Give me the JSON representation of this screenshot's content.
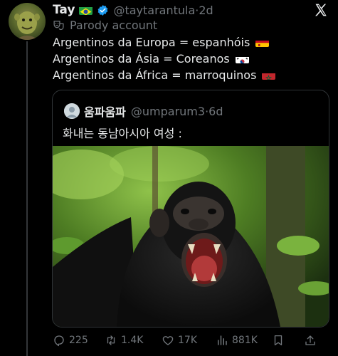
{
  "tweet": {
    "display_name": "Tay",
    "handle": "@taytarantula",
    "time_sep": "·",
    "time": "2d",
    "label": "Parody account",
    "lines": [
      "Argentinos da Europa = espanhóis",
      "Argentinos da Ásia = Coreanos",
      "Argentinos da África = marroquinos"
    ]
  },
  "quote": {
    "display_name": "움파움파",
    "handle": "@umparum3",
    "time_sep": "·",
    "time": "6d",
    "text": "화내는 동남아시아 여성 :"
  },
  "actions": {
    "replies": "225",
    "reposts": "1.4K",
    "likes": "17K",
    "views": "881K"
  },
  "colors": {
    "background": "#000000",
    "text": "#e7e9ea",
    "muted": "#71767b",
    "border": "#2f3336",
    "verified": "#1d9bf0"
  }
}
